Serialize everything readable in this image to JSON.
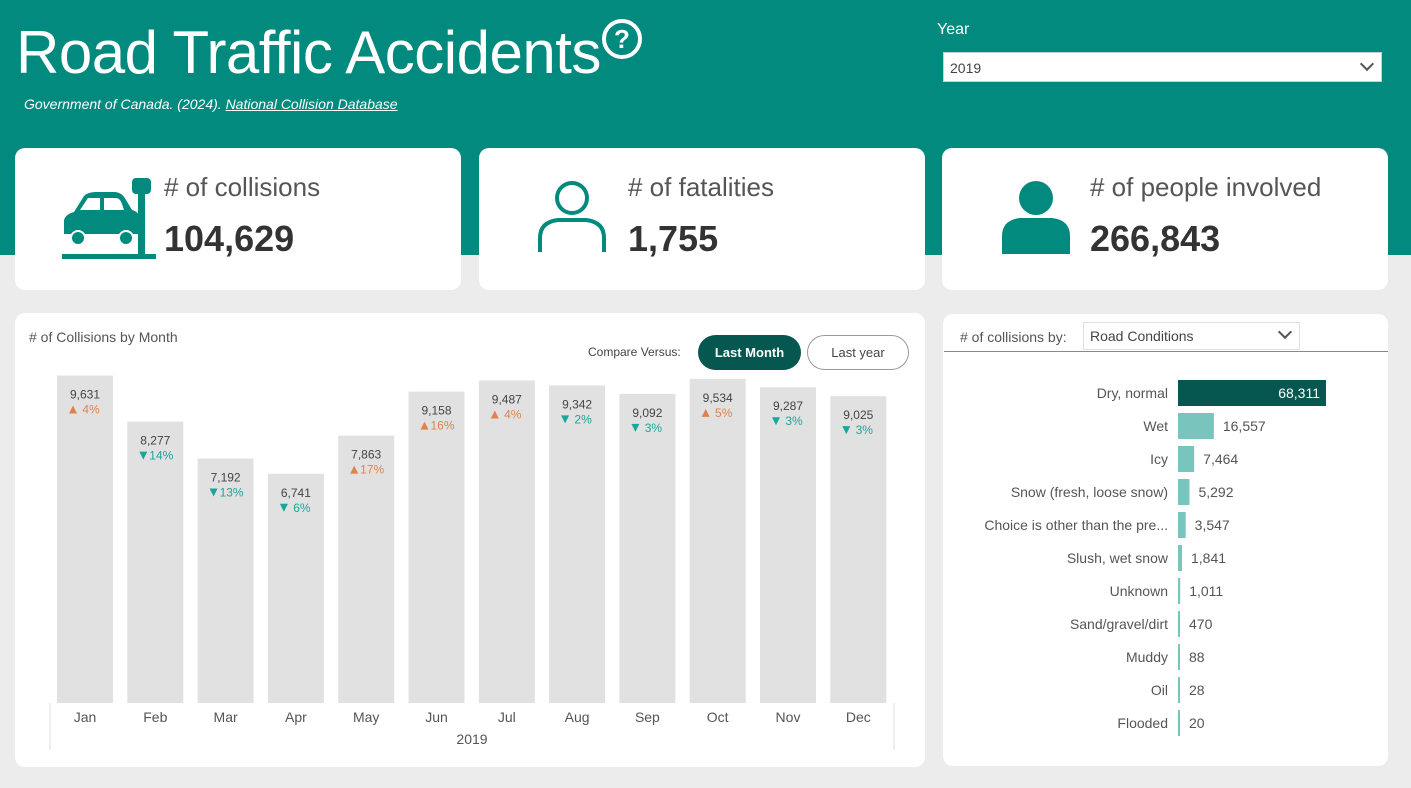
{
  "header": {
    "title": "Road Traffic Accidents",
    "help_glyph": "?",
    "source_text": "Government of Canada. (2024). ",
    "source_link": "National Collision Database",
    "year_label": "Year",
    "year_value": "2019"
  },
  "kpis": [
    {
      "icon": "car-collision-icon",
      "label": "# of collisions",
      "value": "104,629"
    },
    {
      "icon": "person-outline-icon",
      "label": "# of fatalities",
      "value": "1,755"
    },
    {
      "icon": "person-filled-icon",
      "label": "# of people involved",
      "value": "266,843"
    }
  ],
  "colors": {
    "brand": "#028a7e",
    "bar_gray": "#e1e1e1",
    "up_orange": "#e0824c",
    "down_teal": "#1aa79b",
    "bar_dark": "#06574f",
    "bar_light": "#79c4bd"
  },
  "monthly": {
    "title": "# of Collisions by Month",
    "compare_label": "Compare Versus:",
    "buttons": [
      "Last Month",
      "Last year"
    ],
    "active_button": "Last Month"
  },
  "road": {
    "title": "# of collisions by:",
    "dropdown_value": "Road Conditions"
  },
  "chart_data": [
    {
      "type": "bar",
      "title": "# of Collisions by Month",
      "xlabel": "2019",
      "categories": [
        "Jan",
        "Feb",
        "Mar",
        "Apr",
        "May",
        "Jun",
        "Jul",
        "Aug",
        "Sep",
        "Oct",
        "Nov",
        "Dec"
      ],
      "values": [
        9631,
        8277,
        7192,
        6741,
        7863,
        9158,
        9487,
        9342,
        9092,
        9534,
        9287,
        9025
      ],
      "value_labels": [
        "9,631",
        "8,277",
        "7,192",
        "6,741",
        "7,863",
        "9,158",
        "9,487",
        "9,342",
        "9,092",
        "9,534",
        "9,287",
        "9,025"
      ],
      "change_labels": [
        "4%",
        "14%",
        "13%",
        "6%",
        "17%",
        "16%",
        "4%",
        "2%",
        "3%",
        "5%",
        "3%",
        "3%"
      ],
      "change_direction": [
        "up",
        "down",
        "down",
        "down",
        "up",
        "up",
        "up",
        "down",
        "down",
        "up",
        "down",
        "down"
      ],
      "ylim": [
        0,
        10000
      ]
    },
    {
      "type": "bar",
      "orientation": "horizontal",
      "title": "# of collisions by: Road Conditions",
      "categories": [
        "Dry, normal",
        "Wet",
        "Icy",
        "Snow (fresh, loose snow)",
        "Choice is other than the pre...",
        "Slush, wet snow",
        "Unknown",
        "Sand/gravel/dirt",
        "Muddy",
        "Oil",
        "Flooded"
      ],
      "values": [
        68311,
        16557,
        7464,
        5292,
        3547,
        1841,
        1011,
        470,
        88,
        28,
        20
      ],
      "value_labels": [
        "68,311",
        "16,557",
        "7,464",
        "5,292",
        "3,547",
        "1,841",
        "1,011",
        "470",
        "88",
        "28",
        "20"
      ]
    }
  ]
}
